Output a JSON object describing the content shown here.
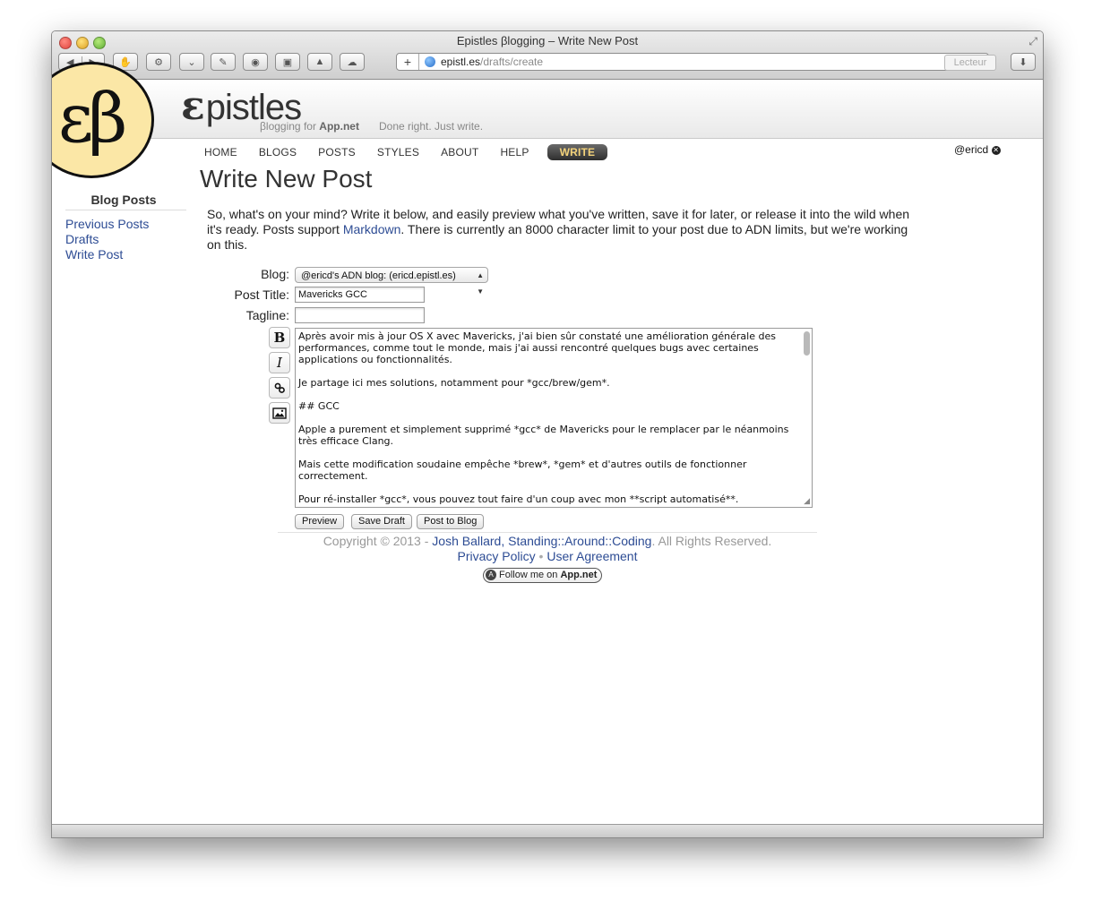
{
  "window": {
    "title": "Epistles βlogging – Write New Post"
  },
  "browser": {
    "url_host": "epistl.es",
    "url_path": "/drafts/create",
    "reader_label": "Lecteur",
    "toolbar_icons": [
      "back-icon",
      "forward-icon",
      "hand-icon",
      "gear-icon",
      "pocket-icon",
      "wrench-icon",
      "eye-icon",
      "crop-icon",
      "rocket-icon",
      "cloud-icon",
      "download-icon"
    ]
  },
  "site": {
    "logo_text": "εβ",
    "brand_initial": "ε",
    "brand_rest": "pistles",
    "tagline_prefix": "βlogging for",
    "tagline_brand": "App.net",
    "tagline_motto": "Done right. Just write."
  },
  "nav": {
    "items": [
      "HOME",
      "BLOGS",
      "POSTS",
      "STYLES",
      "ABOUT",
      "HELP"
    ],
    "write": "WRITE",
    "user": "@ericd"
  },
  "page": {
    "title": "Write New Post"
  },
  "sidebar": {
    "heading": "Blog Posts",
    "links": [
      "Previous Posts",
      "Drafts",
      "Write Post"
    ]
  },
  "intro": {
    "part1": "So, what's on your mind? Write it below, and easily preview what you've written, save it for later, or release it into the wild when it's ready. Posts support ",
    "link": "Markdown",
    "part2": ". There is currently an 8000 character limit to your post due to ADN limits, but we're working on this."
  },
  "form": {
    "blog_label": "Blog:",
    "blog_value": "@ericd's ADN blog: (ericd.epistl.es)",
    "title_label": "Post Title:",
    "title_value": "Mavericks GCC",
    "tagline_label": "Tagline:",
    "tagline_value": "",
    "tools": {
      "bold": "B",
      "italic": "I",
      "link": "link-icon",
      "image": "image-icon"
    },
    "body": "Après avoir mis à jour OS X avec Mavericks, j'ai bien sûr constaté une amélioration générale des performances, comme tout le monde, mais j'ai aussi rencontré quelques bugs avec certaines applications ou fonctionnalités.\n\nJe partage ici mes solutions, notamment pour *gcc/brew/gem*.\n\n## GCC\n\nApple a purement et simplement supprimé *gcc* de Mavericks pour le remplacer par le néanmoins très efficace Clang.\n\nMais cette modification soudaine empêche *brew*, *gem* et d'autres outils de fonctionner correctement.\n\nPour ré-installer *gcc*, vous pouvez tout faire d'un coup avec mon **script automatisé**.",
    "buttons": {
      "preview": "Preview",
      "save": "Save Draft",
      "post": "Post to Blog"
    }
  },
  "footer": {
    "copyright": "Copyright © 2013 - ",
    "author": "Josh Ballard, Standing::Around::Coding",
    "rights": ". All Rights Reserved.",
    "privacy": "Privacy Policy",
    "separator": "•",
    "agreement": "User Agreement",
    "follow_prefix": "Follow me on ",
    "follow_brand": "App.net"
  },
  "colors": {
    "link": "#2d4c94",
    "logo_bg": "#fbe7a6",
    "write_text": "#f3d27a"
  }
}
